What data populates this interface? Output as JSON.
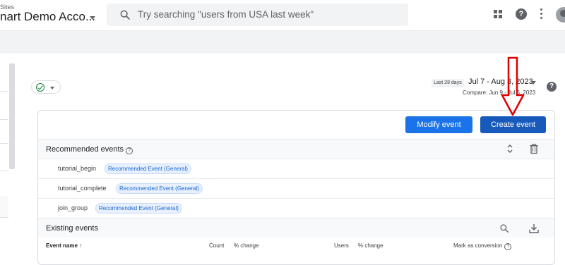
{
  "header": {
    "account_sub": "Sites",
    "account_name": "nart Demo Acco...",
    "search_placeholder": "Try searching \"users from USA last week\"",
    "icons": [
      "search-icon",
      "apps-icon",
      "help-icon",
      "more-vert-icon",
      "avatar"
    ]
  },
  "toolbar": {
    "date_badge": "Last 28 days",
    "date_range": "Jul 7 - Aug 3, 2023",
    "compare": "Compare: Jun 9 - Jul 6, 2023"
  },
  "card": {
    "modify_label": "Modify event",
    "create_label": "Create event",
    "recommended": {
      "title": "Recommended events",
      "rows": [
        {
          "name": "tutorial_begin",
          "tag": "Recommended Event (General)"
        },
        {
          "name": "tutorial_complete",
          "tag": "Recommended Event (General)"
        },
        {
          "name": "join_group",
          "tag": "Recommended Event (General)"
        }
      ]
    },
    "existing": {
      "title": "Existing events",
      "columns": {
        "event_name": "Event name",
        "count": "Count",
        "count_change": "% change",
        "users": "Users",
        "users_change": "% change",
        "conversion": "Mark as conversion"
      }
    }
  },
  "colors": {
    "primary_button": "#1a73e8",
    "create_button": "#185abc",
    "tag_text": "#1967d2",
    "annotation": "#e00000",
    "success": "#188038"
  }
}
